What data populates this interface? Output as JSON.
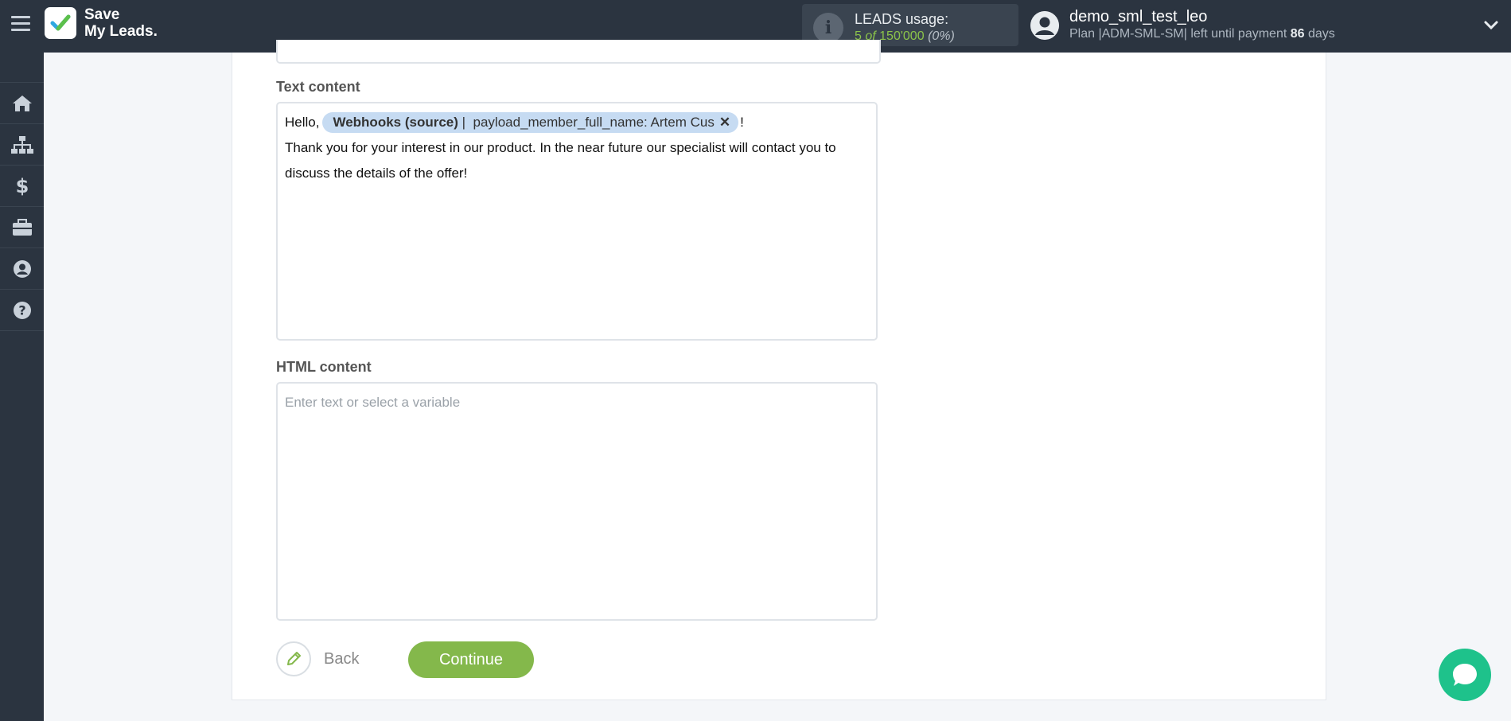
{
  "header": {
    "logo_text_line1": "Save",
    "logo_text_line2": "My Leads.",
    "usage_title": "LEADS usage:",
    "usage_count": "5",
    "usage_of": "of",
    "usage_limit": "150'000",
    "usage_percent": "(0%)",
    "username": "demo_sml_test_leo",
    "plan_prefix": "Plan |ADM-SML-SM| left until payment",
    "plan_days": "86",
    "plan_suffix": "days"
  },
  "sidebar": {
    "items": [
      {
        "icon": "home-icon"
      },
      {
        "icon": "sitemap-icon"
      },
      {
        "icon": "dollar-icon"
      },
      {
        "icon": "briefcase-icon"
      },
      {
        "icon": "user-circle-icon"
      },
      {
        "icon": "question-circle-icon"
      }
    ]
  },
  "form": {
    "text_content_label": "Text content",
    "text_content": {
      "greeting": "Hello,",
      "chip_source": "Webhooks (source)",
      "chip_separator": "|",
      "chip_field": "payload_member_full_name: Artem Cus",
      "exclamation": "!",
      "body": "Thank you for your interest in our product. In the near future our specialist will contact you to discuss the details of the offer!"
    },
    "html_content_label": "HTML content",
    "html_content_placeholder": "Enter text or select a variable",
    "back_label": "Back",
    "continue_label": "Continue"
  },
  "colors": {
    "topbar": "#2b3440",
    "accent_green": "#84b84b",
    "chip_bg": "#c6dbf2",
    "chat_button": "#1ec28b"
  }
}
